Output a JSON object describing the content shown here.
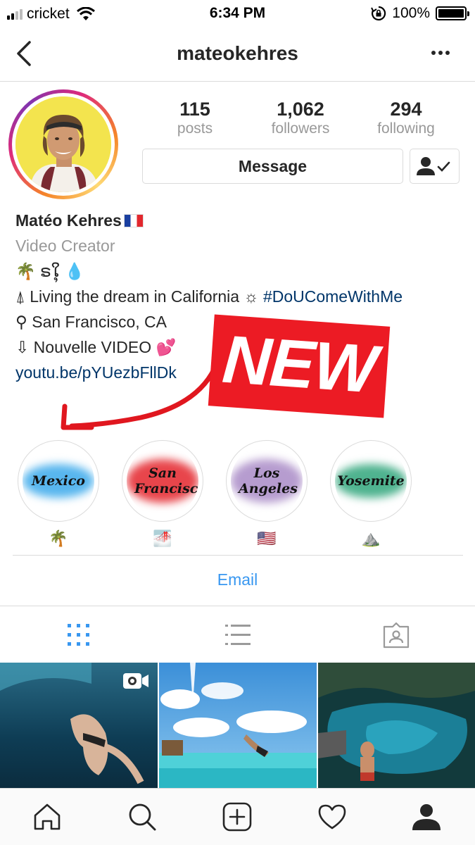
{
  "status_bar": {
    "carrier": "cricket",
    "time": "6:34 PM",
    "battery": "100%"
  },
  "header": {
    "username": "mateokehres"
  },
  "profile": {
    "stats": [
      {
        "value": "115",
        "label": "posts"
      },
      {
        "value": "1,062",
        "label": "followers"
      },
      {
        "value": "294",
        "label": "following"
      }
    ],
    "message_label": "Message"
  },
  "bio": {
    "name": "Matéo Kehres",
    "category": "Video Creator",
    "line1": "🌴 ຣໃຸ 💧",
    "line2_text": "⍋ Living the dream in California ☼ ",
    "line2_hashtag": "#DoUComeWithMe",
    "line3": "⚲ San Francisco, CA",
    "line4": "⇩ Nouvelle VIDEO 💕",
    "link": "youtu.be/pYUezbFllDk"
  },
  "overlay": {
    "new_label": "NEW"
  },
  "highlights": [
    {
      "title": "Mexico",
      "emoji": "🌴",
      "color": "#5ab8ef"
    },
    {
      "title": "San Francisco",
      "emoji": "🌁",
      "color": "#e8454b"
    },
    {
      "title": "Los Angeles",
      "emoji": "🇺🇸",
      "color": "#b69ccf"
    },
    {
      "title": "Yosemite",
      "emoji": "⛰️",
      "color": "#4fb38f"
    }
  ],
  "contact": {
    "email_label": "Email"
  },
  "colors": {
    "link": "#3897f0",
    "hashtag": "#003569",
    "banner": "#ec1b24"
  }
}
